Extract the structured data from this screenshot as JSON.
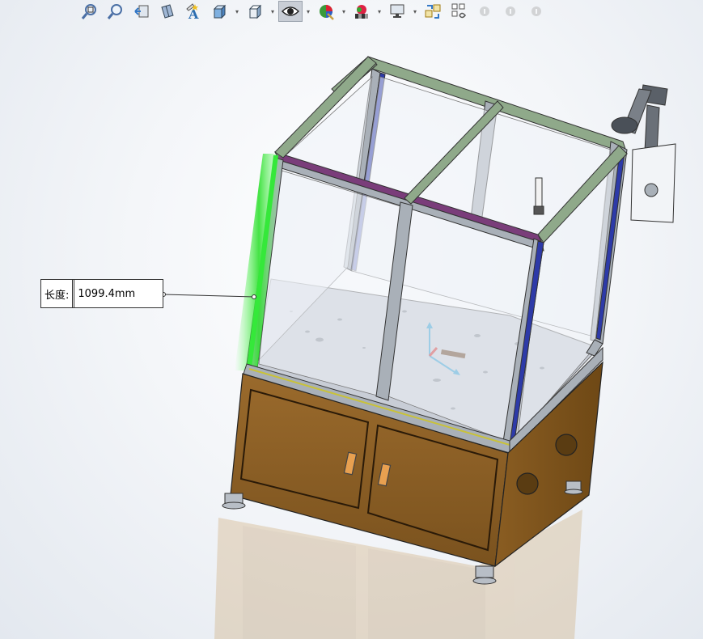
{
  "toolbar": {
    "items": [
      {
        "name": "zoom-to-fit-icon"
      },
      {
        "name": "zoom-to-area-icon"
      },
      {
        "name": "previous-view-icon"
      },
      {
        "name": "section-view-icon"
      },
      {
        "name": "view-dynamic-annotation-icon"
      },
      {
        "name": "view-orientation-icon"
      },
      {
        "name": "display-style-icon"
      },
      {
        "name": "hide-show-items-icon"
      },
      {
        "name": "edit-appearance-icon"
      },
      {
        "name": "apply-scene-icon"
      },
      {
        "name": "view-settings-icon"
      },
      {
        "name": "smart-dimension-icon"
      },
      {
        "name": "assembly-sketch-icon"
      }
    ],
    "active_item": "hide-show-items-icon"
  },
  "measure": {
    "label": "长度:",
    "value": "1099.4mm"
  },
  "colors": {
    "cabinet": "#8b5e26",
    "frame": "#a9b0b8",
    "selected_edge": "#35e83a",
    "accent_blue": "#2d3aa8",
    "accent_purple": "#7a3d7a",
    "floor": "#c9ced8"
  }
}
